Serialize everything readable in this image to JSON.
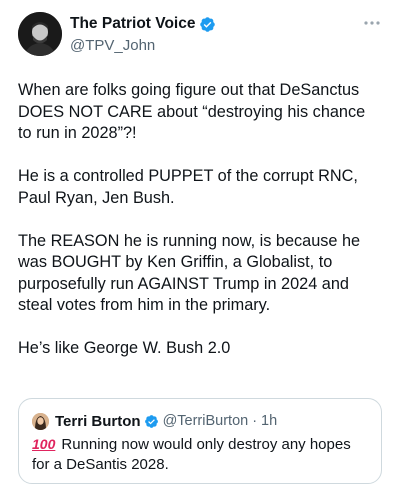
{
  "author": {
    "display_name": "The Patriot Voice",
    "handle": "@TPV_John",
    "verified": true
  },
  "tweet": {
    "paragraphs": [
      "When are folks going figure out that DeSanctus DOES NOT CARE about “destroying his chance to run in 2028”?!",
      "He is a controlled PUPPET of the corrupt RNC, Paul Ryan, Jen Bush.",
      "The REASON he is running now, is because he was BOUGHT by Ken Griffin, a Globalist, to purposefully run AGAINST Trump in 2024 and steal votes from him in the primary.",
      "He’s like George W. Bush 2.0"
    ]
  },
  "quoted_tweet": {
    "display_name": "Terri Burton",
    "handle": "@TerriBurton",
    "time": "· 1h",
    "emoji": "100",
    "text": "Running now would only destroy any hopes for a DeSantis 2028."
  },
  "colors": {
    "verified_blue": "#1d9bf0",
    "secondary_text": "#536471",
    "border": "#cfd9de"
  },
  "icons": {
    "verified": "verified-badge-icon",
    "more": "more-options-icon",
    "hundred": "hundred-points-emoji"
  }
}
